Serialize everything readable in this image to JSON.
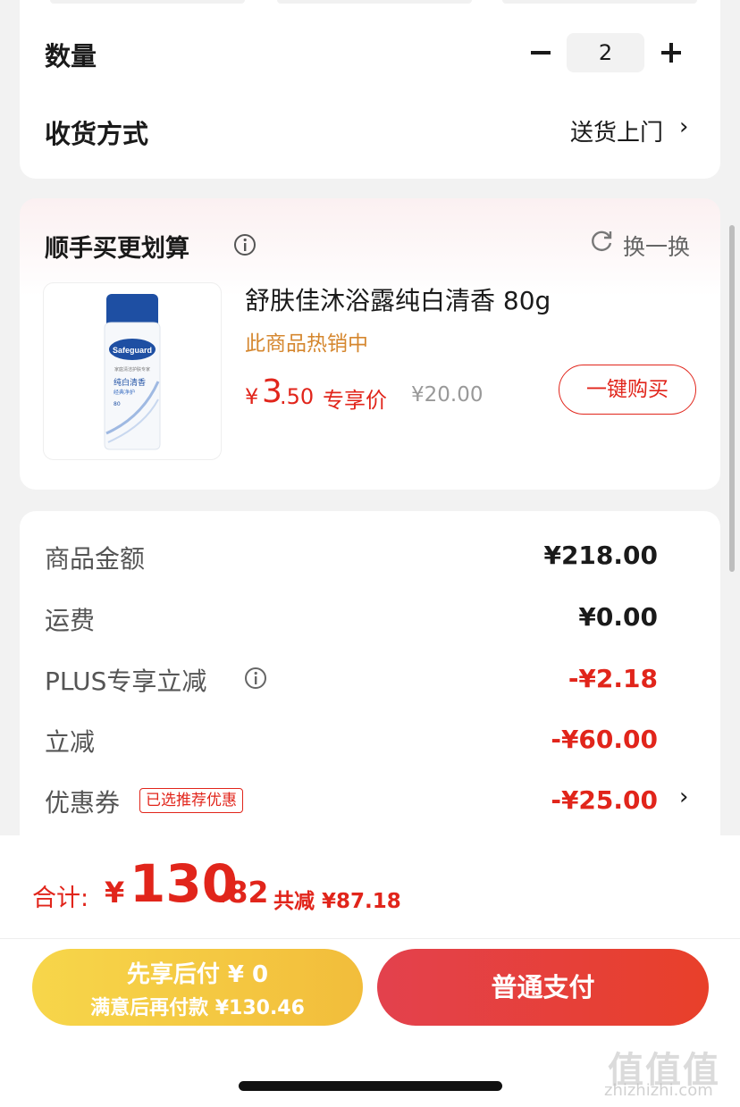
{
  "order": {
    "quantity_label": "数量",
    "quantity_value": "2",
    "delivery_label": "收货方式",
    "delivery_value": "送货上门",
    "chevron": "›"
  },
  "addon": {
    "title": "顺手买更划算",
    "refresh_label": "换一换",
    "product": {
      "name": "舒肤佳沐浴露纯白清香 80g",
      "hot_text": "此商品热销中",
      "price_symbol": "¥",
      "price_integer": "3",
      "price_decimal": ".50",
      "price_tag": "专享价",
      "original_price": "¥20.00",
      "buy_button": "一键购买",
      "image_brand": "Safeguard",
      "image_line1": "纯白清香",
      "image_line2": "经典净护",
      "image_badge": "80",
      "image_tagline": "家庭清洁护肤专家"
    }
  },
  "summary": {
    "rows": [
      {
        "label": "商品金额",
        "value": "¥218.00"
      },
      {
        "label": "运费",
        "value": "¥0.00"
      },
      {
        "label": "PLUS专享立减",
        "value": "-¥2.18"
      },
      {
        "label": "立减",
        "value": "-¥60.00"
      },
      {
        "label": "优惠券",
        "value": "-¥25.00"
      }
    ],
    "coupon_badge": "已选推荐优惠"
  },
  "footer": {
    "total_label": "合计:",
    "total_symbol": "¥",
    "total_integer": "130",
    "total_decimal": ".82",
    "saved_text": "共减 ¥87.18",
    "pay_later_line1": "先享后付 ¥ 0",
    "pay_later_line2": "满意后再付款 ¥130.46",
    "pay_normal": "普通支付"
  },
  "watermark": {
    "mark": "值值值",
    "url": "zhizhizhi.com"
  },
  "colors": {
    "accent_red": "#e1251b",
    "hot_orange": "#d5872f",
    "pay_later_yellow": "#f2bd3b",
    "pay_normal_red": "#e3414d"
  }
}
